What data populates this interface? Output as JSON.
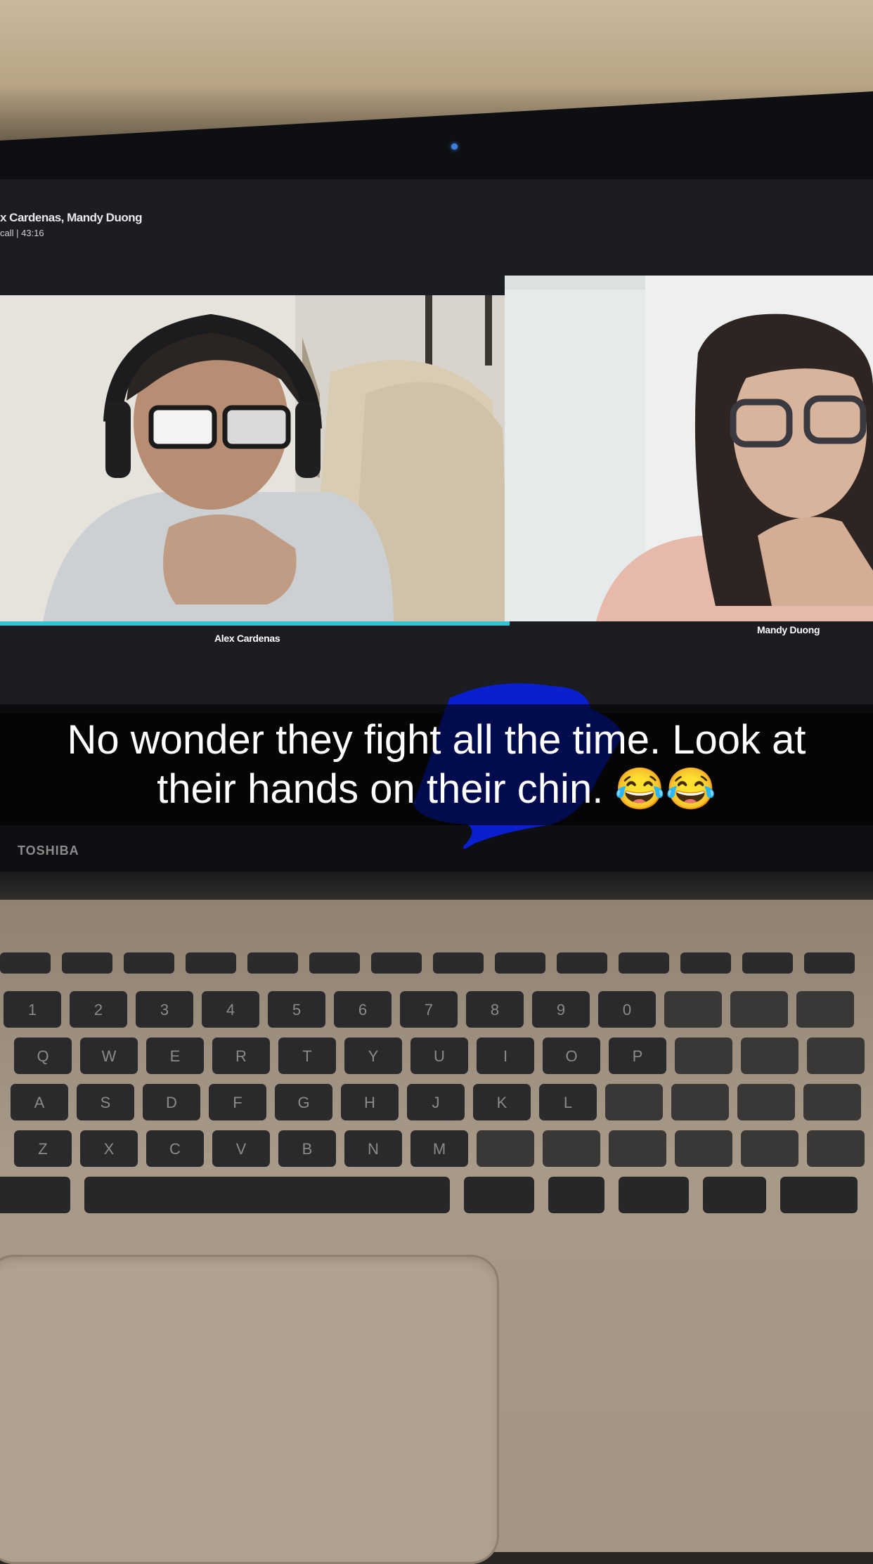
{
  "call": {
    "title": "x Cardenas, Mandy Duong",
    "status": "call | 43:16"
  },
  "participants": [
    {
      "name": "Alex Cardenas",
      "active": true
    },
    {
      "name": "Mandy Duong",
      "active": false
    }
  ],
  "caption": {
    "line1": "No wonder they fight all the time. Look at",
    "line2": "their hands on their chin. 😂😂"
  },
  "laptop": {
    "brand": "TOSHIBA"
  },
  "keyboard_rows": [
    [
      "1",
      "2",
      "3",
      "4",
      "5",
      "6",
      "7",
      "8",
      "9",
      "0"
    ],
    [
      "Q",
      "W",
      "E",
      "R",
      "T",
      "Y",
      "U",
      "I",
      "O",
      "P"
    ],
    [
      "A",
      "S",
      "D",
      "F",
      "G",
      "H",
      "J",
      "K",
      "L"
    ],
    [
      "Z",
      "X",
      "C",
      "V",
      "B",
      "N",
      "M"
    ]
  ],
  "colors": {
    "active_speaker": "#33c4d4",
    "scribble": "#0a1fd0"
  }
}
